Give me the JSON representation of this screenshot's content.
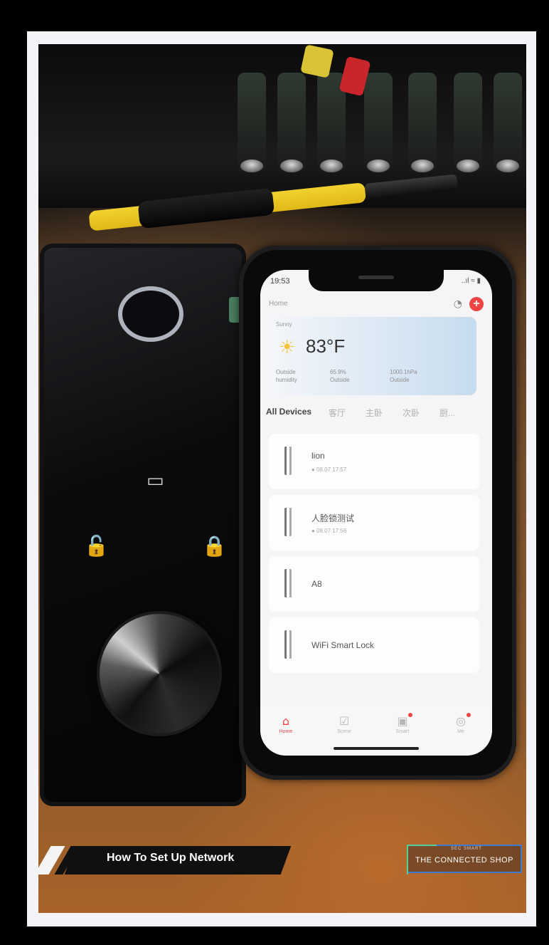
{
  "phone_app": {
    "status_time": "19:53",
    "status_icons": "..ıl ≈ ▮",
    "home_label": "Home",
    "weather": {
      "temperature": "83°F",
      "place": "Sunny",
      "col1": [
        "Outside",
        "humidity"
      ],
      "col2": [
        "65.9%",
        "Outside"
      ],
      "col3": [
        "1000.1hPa",
        "Outside"
      ]
    },
    "tabs": [
      "All Devices",
      "客厅",
      "主卧",
      "次卧",
      "厨..."
    ],
    "devices": [
      {
        "name": "lion",
        "status": "● 08.07 17:57"
      },
      {
        "name": "人脸锁测试",
        "status": "● 08.07 17:56"
      },
      {
        "name": "A8",
        "status": ""
      },
      {
        "name": "WiFi Smart Lock",
        "status": ""
      }
    ],
    "nav": [
      "Home",
      "Scene",
      "Smart",
      "Me"
    ]
  },
  "overlay": {
    "title": "How To Set Up Network",
    "brand_tag": "SEC SMART",
    "brand_name": "THE CONNECTED SHOP"
  },
  "icons": {
    "lock_panel": [
      "fingerprint-icon",
      "card-icon",
      "unlock-icon",
      "lock-icon",
      "knob"
    ],
    "phone": [
      "bell-icon",
      "add-icon",
      "sun-icon",
      "lock-device-icon",
      "home-icon",
      "scene-icon",
      "smart-icon",
      "me-icon"
    ]
  },
  "colors": {
    "accent": "#f04444",
    "banner": "#101010",
    "brand_border": "#3c7ad0",
    "brand_corner": "#4fd1a0"
  }
}
